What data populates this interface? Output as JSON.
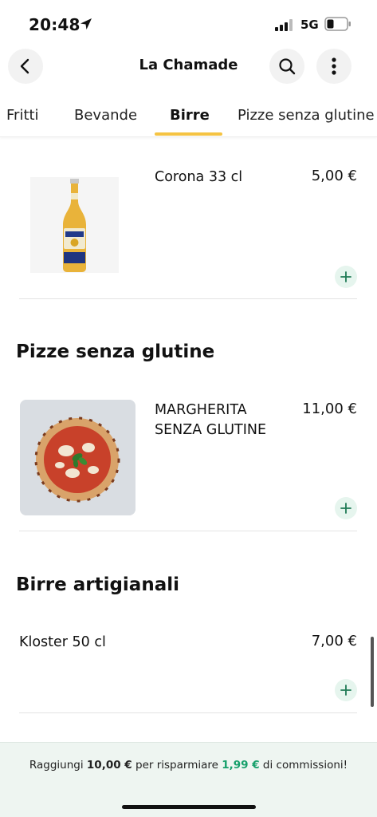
{
  "status_bar": {
    "time": "20:48",
    "network": "5G"
  },
  "header": {
    "title": "La Chamade"
  },
  "tabs": [
    {
      "label": "Fritti",
      "active": false
    },
    {
      "label": "Bevande",
      "active": false
    },
    {
      "label": "Birre",
      "active": true
    },
    {
      "label": "Pizze senza glutine",
      "active": false
    }
  ],
  "items": {
    "corona": {
      "name": "Corona 33 cl",
      "price": "5,00 €"
    },
    "margherita": {
      "name_line1": "MARGHERITA",
      "name_line2": "SENZA GLUTINE",
      "price": "11,00 €"
    },
    "kloster": {
      "name": "Kloster 50 cl",
      "price": "7,00 €"
    }
  },
  "sections": {
    "pizze_senza_glutine": "Pizze senza glutine",
    "birre_artigianali": "Birre artigianali"
  },
  "banner": {
    "prefix": "Raggiungi ",
    "amount": "10,00 €",
    "middle": " per risparmiare ",
    "savings": "1,99 €",
    "suffix": " di commissioni!"
  },
  "colors": {
    "accent_tab": "#f5c342",
    "add_button_bg": "#e6f5ee",
    "add_button_fg": "#1f7a55",
    "savings_green": "#16a06b"
  }
}
